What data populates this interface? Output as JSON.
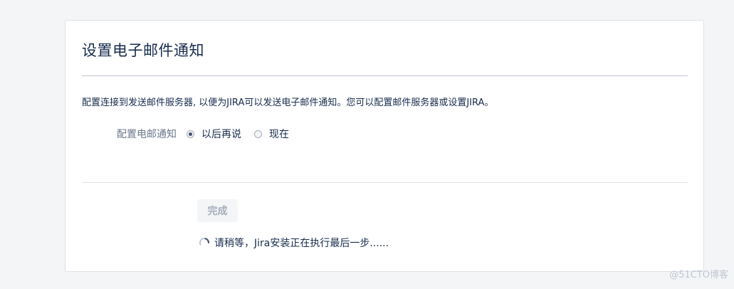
{
  "panel": {
    "title": "设置电子邮件通知",
    "description": "配置连接到发送邮件服务器, 以便为JIRA可以发送电子邮件通知。您可以配置邮件服务器或设置JIRA。"
  },
  "email_config": {
    "label": "配置电邮通知",
    "options": [
      {
        "label": "以后再说",
        "selected": true
      },
      {
        "label": "现在",
        "selected": false
      }
    ]
  },
  "actions": {
    "done_label": "完成"
  },
  "status": {
    "text": "请稍等，Jira安装正在执行最后一步......"
  },
  "watermark": "@51CTO博客",
  "colors": {
    "text": "#172b4d",
    "muted": "#6b778c",
    "disabled": "#a5adba"
  }
}
